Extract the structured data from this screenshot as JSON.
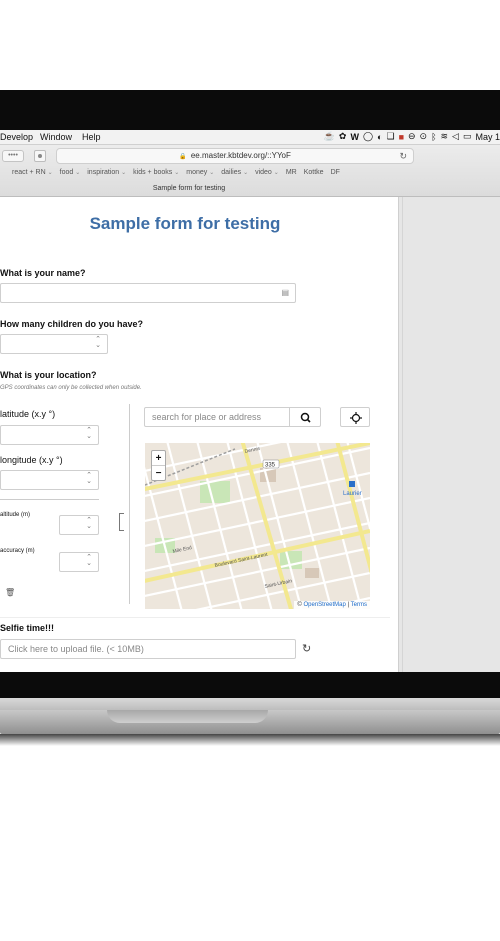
{
  "menubar": {
    "items": [
      "Develop",
      "Window",
      "Help"
    ],
    "date": "May 1"
  },
  "browser": {
    "url": "ee.master.kbtdev.org/::YYoF",
    "tab_title": "Sample form for testing",
    "bookmarks": [
      {
        "label": "react + RN",
        "caret": true
      },
      {
        "label": "food",
        "caret": true
      },
      {
        "label": "inspiration",
        "caret": true
      },
      {
        "label": "kids + books",
        "caret": true
      },
      {
        "label": "money",
        "caret": true
      },
      {
        "label": "dailies",
        "caret": true
      },
      {
        "label": "video",
        "caret": true
      },
      {
        "label": "MR",
        "caret": false
      },
      {
        "label": "Kottke",
        "caret": false
      },
      {
        "label": "DF",
        "caret": false
      }
    ]
  },
  "form": {
    "title": "Sample form for testing",
    "name_question": "What is your name?",
    "children_question": "How many children do you have?",
    "location_question": "What is your location?",
    "location_hint": "GPS coordinates can only be collected when outside.",
    "latitude_label": "latitude (x.y °)",
    "longitude_label": "longitude (x.y °)",
    "altitude_label": "altitude (m)",
    "accuracy_label": "accuracy (m)",
    "search_placeholder": "search for place or address",
    "map": {
      "zoom_in": "+",
      "zoom_out": "−",
      "attribution_prefix": "©",
      "attribution_osm": "OpenStreetMap",
      "attribution_sep": " | ",
      "attribution_terms": "Terms",
      "labels": {
        "route": "335",
        "station": "Laurier",
        "street1": "Boulevard Saint-Laurent",
        "street2": "Mile End",
        "street3": "Saint-Urbain",
        "street4": "Dennis"
      }
    },
    "selfie_question": "Selfie time!!!",
    "upload_placeholder": "Click here to upload file. (< 10MB)"
  },
  "icons": {
    "lock": "🔒",
    "reload": "↻",
    "search": "🔍",
    "crosshair": "⌖",
    "trash": "🗑",
    "refresh": "↻",
    "nav_dots": "••••"
  }
}
